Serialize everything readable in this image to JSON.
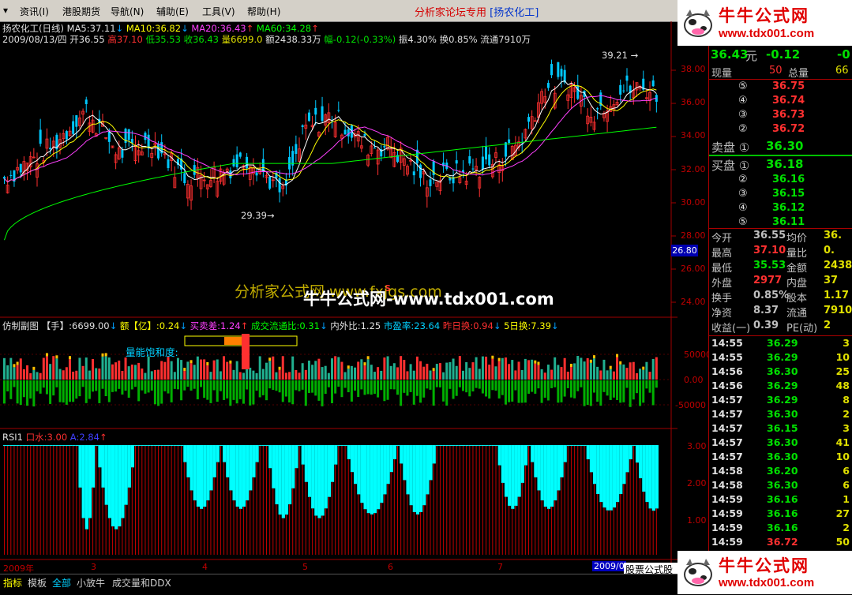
{
  "menu": {
    "items": [
      "资讯(I)",
      "港股期货",
      "导航(N)",
      "辅助(E)",
      "工具(V)",
      "帮助(H)"
    ],
    "title": "分析家论坛专用",
    "stock_tag": "[扬农化工]"
  },
  "logo": {
    "cn": "牛牛公式网",
    "url": "www.tdx001.com"
  },
  "main": {
    "name": "扬农化工(日线)",
    "ma5": "MA5:37.11",
    "ma10": "MA10:36.82",
    "ma20": "MA20:36.43",
    "ma60": "MA60:34.28",
    "date_line": "2009/08/13/四 开36.55",
    "high": "高37.10",
    "low": "低35.53",
    "close": "收36.43",
    "vol": "量6699.0",
    "amt": "额2438.33万",
    "chg": "幅-0.12(-0.33%)",
    "amp": "振4.30% 换0.85% 流通7910万",
    "price_ticks": [
      "38.00",
      "36.00",
      "34.00",
      "32.00",
      "30.00",
      "28.00",
      "26.00",
      "24.00"
    ],
    "current_price_tag": "26.80",
    "high_mark": "39.21",
    "low_mark": "29.39",
    "watermark1": "分析家公式网 www.fxjgs.com",
    "watermark2": "牛牛公式网-www.tdx001.com",
    "s_mark": "S"
  },
  "sub1": {
    "name": "仿制副图",
    "hand": "【手】:6699.00",
    "amt": "额【亿】:0.24",
    "buysell": "买卖差:1.24",
    "ratio": "成交流通比:0.31",
    "inout": "内外比:1.25",
    "pe": "市盈率:23.64",
    "prevturn": "昨日换:0.94",
    "turn5": "5日换:7.39",
    "sat": "量能饱和度:",
    "ticks": [
      "50000",
      "0.00",
      "-50000"
    ]
  },
  "sub2": {
    "name": "RSI1",
    "water": "口水:3.00",
    "a": "A:2.84",
    "ticks": [
      "3.00",
      "2.00",
      "1.00"
    ]
  },
  "xaxis": {
    "labels": [
      "2009年",
      "3",
      "4",
      "5",
      "6",
      "7"
    ],
    "date_box": "2009/0",
    "footer_tag": "股票公式股票"
  },
  "tabs": [
    "指标",
    "模板",
    "全部",
    "小放牛",
    "成交量和DDX"
  ],
  "panel": {
    "price": "36.43",
    "unit": "元",
    "change": "-0.12",
    "change2": "-0",
    "now_vol_label": "现量",
    "now_vol": "50",
    "total_vol_label": "总量",
    "total_vol": "66",
    "sells": [
      {
        "label": "⑤",
        "price": "36.75"
      },
      {
        "label": "④",
        "price": "36.74"
      },
      {
        "label": "③",
        "price": "36.73"
      },
      {
        "label": "②",
        "price": "36.72"
      }
    ],
    "sell1_label": "卖盘 ①",
    "sell1": "36.30",
    "buy1_label": "买盘 ①",
    "buy1": "36.18",
    "buys": [
      {
        "label": "②",
        "price": "36.16"
      },
      {
        "label": "③",
        "price": "36.15"
      },
      {
        "label": "④",
        "price": "36.12"
      },
      {
        "label": "⑤",
        "price": "36.11"
      }
    ],
    "stats": [
      {
        "l1": "今开",
        "v1": "36.55",
        "l2": "均价",
        "v2": "36.",
        "c1": "#c0c0c0"
      },
      {
        "l1": "最高",
        "v1": "37.10",
        "l2": "量比",
        "v2": "0.",
        "c1": "#ff3030"
      },
      {
        "l1": "最低",
        "v1": "35.53",
        "l2": "金额",
        "v2": "2438",
        "c1": "#00e000"
      },
      {
        "l1": "外盘",
        "v1": "2977",
        "l2": "内盘",
        "v2": "37",
        "c1": "#ff3030"
      },
      {
        "l1": "换手",
        "v1": "0.85%",
        "l2": "股本",
        "v2": "1.17",
        "c1": "#c0c0c0"
      },
      {
        "l1": "净资",
        "v1": "8.37",
        "l2": "流通",
        "v2": "7910",
        "c1": "#c0c0c0"
      },
      {
        "l1": "收益(一)",
        "v1": "0.39",
        "l2": "PE(动)",
        "v2": "2",
        "c1": "#c0c0c0"
      }
    ],
    "ticks": [
      {
        "t": "14:55",
        "p": "36.29",
        "v": "3",
        "c": "#00e000"
      },
      {
        "t": "14:55",
        "p": "36.29",
        "v": "10",
        "c": "#00e000"
      },
      {
        "t": "14:56",
        "p": "36.30",
        "v": "25",
        "c": "#00e000"
      },
      {
        "t": "14:56",
        "p": "36.29",
        "v": "48",
        "c": "#00e000"
      },
      {
        "t": "14:57",
        "p": "36.29",
        "v": "8",
        "c": "#00e000"
      },
      {
        "t": "14:57",
        "p": "36.30",
        "v": "2",
        "c": "#00e000"
      },
      {
        "t": "14:57",
        "p": "36.15",
        "v": "3",
        "c": "#00e000"
      },
      {
        "t": "14:57",
        "p": "36.30",
        "v": "41",
        "c": "#00e000"
      },
      {
        "t": "14:57",
        "p": "36.30",
        "v": "10",
        "c": "#00e000"
      },
      {
        "t": "14:58",
        "p": "36.20",
        "v": "6",
        "c": "#00e000"
      },
      {
        "t": "14:58",
        "p": "36.30",
        "v": "6",
        "c": "#00e000"
      },
      {
        "t": "14:59",
        "p": "36.16",
        "v": "1",
        "c": "#00e000"
      },
      {
        "t": "14:59",
        "p": "36.16",
        "v": "27",
        "c": "#00e000"
      },
      {
        "t": "14:59",
        "p": "36.16",
        "v": "2",
        "c": "#00e000"
      },
      {
        "t": "14:59",
        "p": "36.72",
        "v": "50",
        "c": "#ff3030"
      }
    ]
  }
}
